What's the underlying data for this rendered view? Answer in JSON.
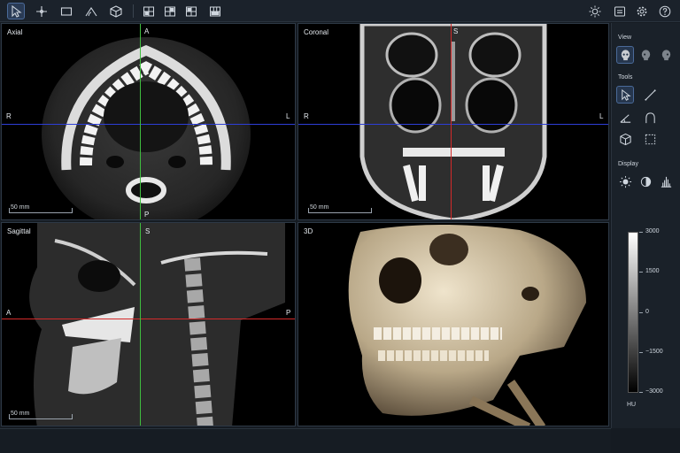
{
  "toolbar": {
    "left_tools": [
      "pointer-icon",
      "crosshair-icon",
      "rectangle-icon",
      "angle-icon",
      "cube-icon"
    ],
    "layout_buttons": [
      "layout-2x2-icon",
      "layout-1-plus-3-icon",
      "layout-3-plus-1-icon",
      "layout-1x3-icon"
    ],
    "right_tools": [
      "brightness-icon",
      "screen-icon",
      "gear-icon",
      "help-icon"
    ]
  },
  "viewports": {
    "axial": {
      "label": "Axial",
      "top": "A",
      "bottom": "P",
      "left": "R",
      "right": "L",
      "scale": "50 mm"
    },
    "coronal": {
      "label": "Coronal",
      "top": "S",
      "left": "R",
      "right": "L",
      "scale": "50 mm"
    },
    "sagittal": {
      "label": "Sagittal",
      "top": "S",
      "left": "A",
      "right": "P",
      "scale": "50 mm"
    },
    "vr": {
      "label": "3D"
    }
  },
  "sidebar": {
    "view_title": "View",
    "tools_title": "Tools",
    "display_title": "Display",
    "hu_labels": [
      "3000",
      "1500",
      "0",
      "−1500",
      "−3000"
    ],
    "hu_unit": "HU"
  },
  "colors": {
    "crosshair_h": "#2d3ed8",
    "crosshair_v": "#3fbf3f",
    "crosshair_red": "#d42a2a",
    "accent": "#4a6a99"
  }
}
